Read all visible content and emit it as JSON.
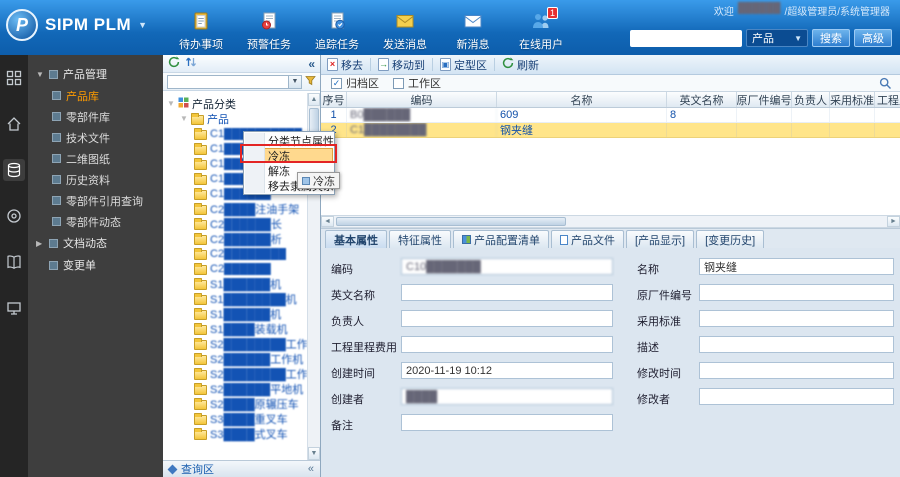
{
  "header": {
    "logo_badge": "P",
    "logo_text": "SIPM PLM",
    "welcome": "欢迎",
    "user": "██████",
    "path": "/超级管理员/系统管理器",
    "toolbar": [
      {
        "label": "待办事项"
      },
      {
        "label": "预警任务"
      },
      {
        "label": "追踪任务"
      },
      {
        "label": "发送消息"
      },
      {
        "label": "新消息"
      },
      {
        "label": "在线用户",
        "badge": "1"
      }
    ],
    "search": {
      "value": "",
      "category": "产品",
      "search_label": "搜索",
      "advanced_label": "高级"
    }
  },
  "nav": {
    "section_product": "产品管理",
    "items": [
      {
        "label": "产品库",
        "active": true
      },
      {
        "label": "零部件库"
      },
      {
        "label": "技术文件"
      },
      {
        "label": "二维图纸"
      },
      {
        "label": "历史资料"
      },
      {
        "label": "零部件引用查询"
      },
      {
        "label": "零部件动态"
      }
    ],
    "section_docs": "文档动态",
    "section_change": "变更单"
  },
  "tree": {
    "root_label": "产品分类",
    "parent_label": "产品",
    "items": [
      {
        "label": "C1██████████"
      },
      {
        "label": "C1████████"
      },
      {
        "label": "C1██████"
      },
      {
        "label": "C1████████"
      },
      {
        "label": "C1██████"
      },
      {
        "label": "C2████注油手架"
      },
      {
        "label": "C2██████长"
      },
      {
        "label": "C2██████析"
      },
      {
        "label": "C2████████"
      },
      {
        "label": "C2██████"
      },
      {
        "label": "S1██████机"
      },
      {
        "label": "S1████████机"
      },
      {
        "label": "S1██████机"
      },
      {
        "label": "S1████装载机"
      },
      {
        "label": "S2████████工作机"
      },
      {
        "label": "S2██████工作机"
      },
      {
        "label": "S2████████工作机"
      },
      {
        "label": "S2██████平地机"
      },
      {
        "label": "S2████原辗压车"
      },
      {
        "label": "S3████重叉车"
      },
      {
        "label": "S3████式叉车"
      }
    ],
    "footer_tab": "查询区"
  },
  "context_menu": {
    "items": [
      {
        "label": "分类节点属性"
      },
      {
        "label": "冷冻",
        "hot": true
      },
      {
        "label": "解冻"
      },
      {
        "label": "移去隶属关系"
      }
    ],
    "drag_tip": "冷冻"
  },
  "main": {
    "toolbar": {
      "remove": "移去",
      "move_to": "移动到",
      "fix_zone": "定型区",
      "refresh": "刷新"
    },
    "filters": {
      "archive": "归档区",
      "work": "工作区"
    },
    "table": {
      "columns": [
        "序号",
        "编码",
        "名称",
        "英文名称",
        "原厂件编号",
        "负责人",
        "采用标准",
        "工程里程碑"
      ],
      "rows": [
        {
          "no": "1",
          "code": "B0██████",
          "name": "609",
          "en_name": "8"
        },
        {
          "no": "2",
          "code": "C1████████",
          "name": "钢夹缝",
          "en_name": ""
        }
      ]
    },
    "tabs": [
      {
        "label": "基本属性",
        "active": true
      },
      {
        "label": "特征属性"
      },
      {
        "label": "产品配置清单"
      },
      {
        "label": "产品文件"
      },
      {
        "label": "[产品显示]"
      },
      {
        "label": "[变更历史]"
      }
    ],
    "form": {
      "fields": [
        {
          "label": "编码",
          "value": "C10███████"
        },
        {
          "label": "名称",
          "value": "钢夹缝"
        },
        {
          "label": "英文名称",
          "value": ""
        },
        {
          "label": "原厂件编号",
          "value": ""
        },
        {
          "label": "负责人",
          "value": ""
        },
        {
          "label": "采用标准",
          "value": ""
        },
        {
          "label": "工程里程费用",
          "value": ""
        },
        {
          "label": "描述",
          "value": ""
        },
        {
          "label": "创建时间",
          "value": "2020-11-19 10:12"
        },
        {
          "label": "修改时间",
          "value": ""
        },
        {
          "label": "创建者",
          "value": "████"
        },
        {
          "label": "修改者",
          "value": ""
        },
        {
          "label": "备注",
          "value": ""
        }
      ]
    }
  }
}
